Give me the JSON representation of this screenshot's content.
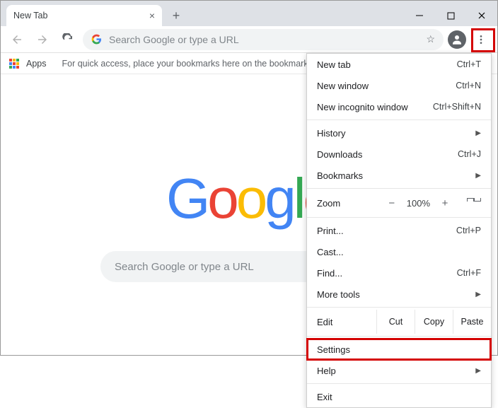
{
  "tab": {
    "title": "New Tab"
  },
  "omnibox": {
    "placeholder": "Search Google or type a URL"
  },
  "bookmarks": {
    "apps": "Apps",
    "hint": "For quick access, place your bookmarks here on the bookmarks ba"
  },
  "logo": {
    "g1": "G",
    "o1": "o",
    "o2": "o",
    "g2": "g",
    "l": "l",
    "e": "e"
  },
  "searchbox": {
    "placeholder": "Search Google or type a URL"
  },
  "menu": {
    "new_tab": {
      "label": "New tab",
      "shortcut": "Ctrl+T"
    },
    "new_window": {
      "label": "New window",
      "shortcut": "Ctrl+N"
    },
    "new_incognito": {
      "label": "New incognito window",
      "shortcut": "Ctrl+Shift+N"
    },
    "history": "History",
    "downloads": {
      "label": "Downloads",
      "shortcut": "Ctrl+J"
    },
    "bookmarks": "Bookmarks",
    "zoom": {
      "label": "Zoom",
      "value": "100%"
    },
    "print": {
      "label": "Print...",
      "shortcut": "Ctrl+P"
    },
    "cast": "Cast...",
    "find": {
      "label": "Find...",
      "shortcut": "Ctrl+F"
    },
    "more_tools": "More tools",
    "edit": {
      "label": "Edit",
      "cut": "Cut",
      "copy": "Copy",
      "paste": "Paste"
    },
    "settings": "Settings",
    "help": "Help",
    "exit": "Exit"
  }
}
